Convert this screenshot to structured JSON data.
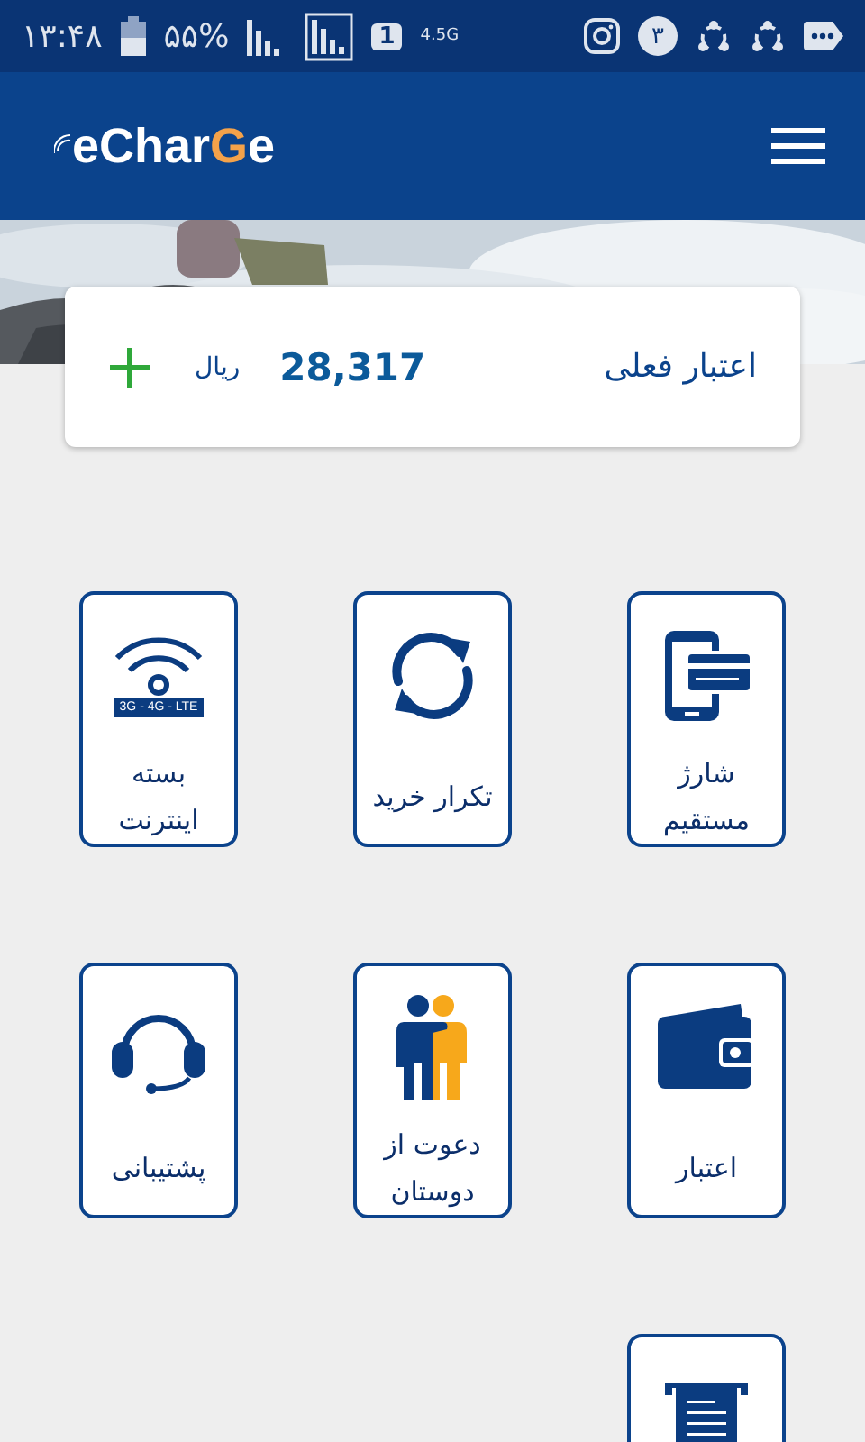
{
  "status_bar": {
    "time": "۱۳:۴۸",
    "battery": "۵۵%",
    "sim": "1",
    "network": "4.5G",
    "badge": "۳"
  },
  "header": {
    "logo": {
      "text": "eChar",
      "accent": "G",
      "tail": "e"
    }
  },
  "balance": {
    "label": "اعتبار فعلی",
    "amount": "28,317",
    "currency": "ریال"
  },
  "tiles": [
    {
      "kind": "phone-card",
      "label": "شارژ مستقیم"
    },
    {
      "kind": "refresh",
      "label": "تکرار خرید"
    },
    {
      "kind": "wifi",
      "label": "بسته اینترنت",
      "badge": "3G - 4G - LTE"
    },
    {
      "kind": "wallet",
      "label": "اعتبار"
    },
    {
      "kind": "friends",
      "label": "دعوت از دوستان"
    },
    {
      "kind": "headset",
      "label": "پشتیبانی"
    },
    {
      "kind": "receipt"
    }
  ]
}
